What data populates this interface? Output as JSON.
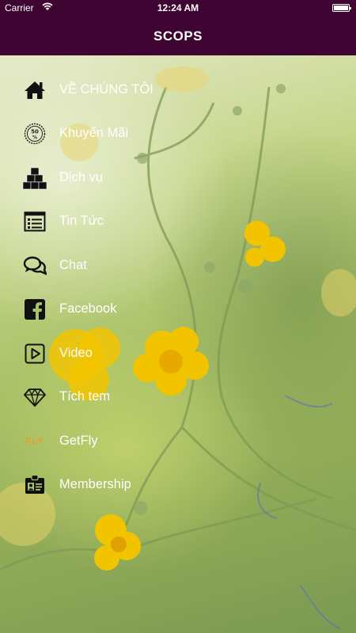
{
  "status_bar": {
    "carrier": "Carrier",
    "time": "12:24 AM"
  },
  "header": {
    "title": "SCOPS"
  },
  "colors": {
    "header_bg": "#3e0432",
    "menu_text": "#ffffff",
    "getfly_logo": "#f29a1f"
  },
  "menu": {
    "items": [
      {
        "label": "VỀ CHÚNG TÔI",
        "icon": "home-icon"
      },
      {
        "label": "Khuyến Mãi",
        "icon": "discount-badge-icon"
      },
      {
        "label": "Dịch vụ",
        "icon": "cubes-icon"
      },
      {
        "label": "Tin Tức",
        "icon": "news-list-icon"
      },
      {
        "label": "Chat",
        "icon": "chat-bubbles-icon"
      },
      {
        "label": "Facebook",
        "icon": "facebook-icon"
      },
      {
        "label": "Video",
        "icon": "video-play-icon"
      },
      {
        "label": "Tích tem",
        "icon": "diamond-icon"
      },
      {
        "label": "GetFly",
        "icon": "getfly-logo-icon"
      },
      {
        "label": "Membership",
        "icon": "membership-card-icon"
      }
    ]
  },
  "getfly_logo_text": "FLY"
}
